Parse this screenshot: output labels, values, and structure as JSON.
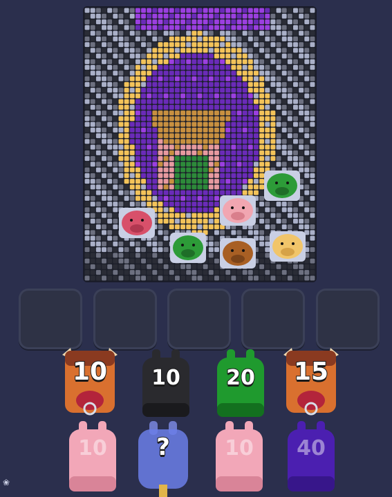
{
  "board": {
    "colors": {
      "dark": "#2a2c36",
      "gray": "#6d7080",
      "light": "#aab0c8",
      "purple": "#6a2bb8",
      "violet": "#9b3fe0",
      "yellow": "#f3c35a",
      "brown": "#c89040",
      "green": "#2d8a3a",
      "pink": "#e79aa0"
    },
    "pigs": [
      {
        "id": "pig-green-top",
        "color": "green"
      },
      {
        "id": "pig-pink-mid",
        "color": "pink"
      },
      {
        "id": "pig-red-left",
        "color": "red"
      },
      {
        "id": "pig-green-bottom",
        "color": "green"
      },
      {
        "id": "pig-brown-bottom",
        "color": "brown"
      },
      {
        "id": "pig-cream-bottom",
        "color": "cream"
      }
    ]
  },
  "slots": {
    "count": 5
  },
  "shooters": {
    "row1": [
      {
        "label": "10",
        "type": "bull",
        "color": "#d9702f"
      },
      {
        "label": "10",
        "type": "pig",
        "color": "#2a2a2e"
      },
      {
        "label": "20",
        "type": "pig",
        "color": "#1f9a2e"
      },
      {
        "label": "15",
        "type": "bull",
        "color": "#d9702f"
      }
    ],
    "row2": [
      {
        "label": "10",
        "type": "pig",
        "color": "#f2a7b8"
      },
      {
        "label": "?",
        "type": "mystery",
        "color": "#6b7ee8"
      },
      {
        "label": "10",
        "type": "pig",
        "color": "#f2a7b8"
      },
      {
        "label": "40",
        "type": "pig",
        "color": "#4b1fb0"
      }
    ]
  }
}
